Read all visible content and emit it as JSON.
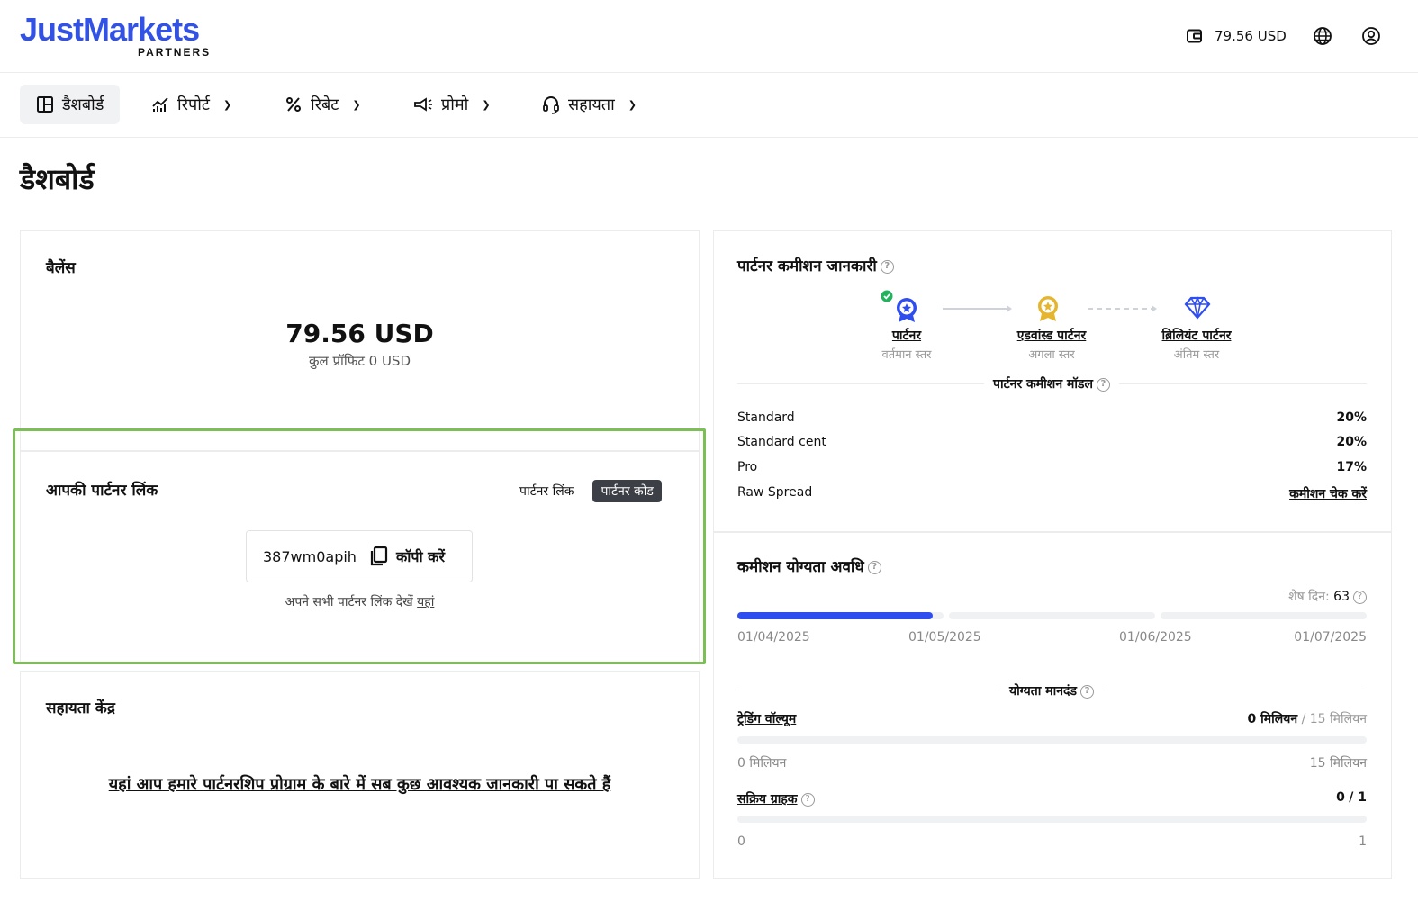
{
  "brand": {
    "name": "JustMarkets",
    "sub": "PARTNERS",
    "color": "#3252e6"
  },
  "header": {
    "balance": "79.56 USD",
    "icons": [
      "wallet-icon",
      "globe-icon",
      "account-icon"
    ]
  },
  "nav": {
    "items": [
      {
        "label": "डैशबोर्ड",
        "icon": "dashboard-icon",
        "active": true
      },
      {
        "label": "रिपोर्ट",
        "icon": "chart-icon",
        "has_dropdown": true
      },
      {
        "label": "रिबेट",
        "icon": "percent-icon",
        "has_dropdown": true
      },
      {
        "label": "प्रोमो",
        "icon": "megaphone-icon",
        "has_dropdown": true
      },
      {
        "label": "सहायता",
        "icon": "headset-icon",
        "has_dropdown": true
      }
    ]
  },
  "page": {
    "title": "डैशबोर्ड"
  },
  "balance_card": {
    "title": "बैलेंस",
    "amount": "79.56 USD",
    "profit": "कुल प्रॉफिट 0 USD"
  },
  "partner_link_card": {
    "title": "आपकी पार्टनर लिंक",
    "toggle": {
      "link_label": "पार्टनर लिंक",
      "code_label": "पार्टनर कोड",
      "selected": "code"
    },
    "code": "387wm0apih",
    "copy_label": "कॉपी करें",
    "see_all_prefix": "अपने सभी पार्टनर लिंक देखें",
    "see_all_link": "यहां"
  },
  "help_card": {
    "title": "सहायता केंद्र",
    "link": "यहां आप हमारे पार्टनरशिप प्रोग्राम के बारे में सब कुछ आवश्यक जानकारी पा सकते हैं"
  },
  "commission_card": {
    "title": "पार्टनर कमीशन जानकारी",
    "levels": [
      {
        "name": "पार्टनर",
        "sub": "वर्तमान स्तर",
        "icon": "partner-badge-icon",
        "color": "#2f4ef0",
        "done": true
      },
      {
        "name": "एडवांस्ड पार्टनर",
        "sub": "अगला स्तर",
        "icon": "advanced-badge-icon",
        "color": "#e6b52e"
      },
      {
        "name": "ब्रिलियंट पार्टनर",
        "sub": "अंतिम स्तर",
        "icon": "diamond-icon",
        "color": "#2f4ef0"
      }
    ],
    "model_title": "पार्टनर कमीशन मॉडल",
    "rates": [
      {
        "account": "Standard",
        "value": "20%"
      },
      {
        "account": "Standard cent",
        "value": "20%"
      },
      {
        "account": "Pro",
        "value": "17%"
      },
      {
        "account": "Raw Spread",
        "value": "कमीशन चेक करें"
      }
    ]
  },
  "eligibility_card": {
    "title": "कमीशन योग्यता अवधि",
    "remaining_label": "शेष दिन:",
    "remaining_days": "63",
    "progress_fraction": 0.31,
    "dates": [
      "01/04/2025",
      "01/05/2025",
      "01/06/2025",
      "01/07/2025"
    ],
    "criteria_title": "योग्यता मानदंड",
    "volume": {
      "label": "ट्रेडिंग वॉल्यूम",
      "current": "0 मिलियन",
      "target": "/ 15 मिलियन",
      "min": "0 मिलियन",
      "max": "15 मिलियन",
      "progress": 0
    },
    "clients": {
      "label": "सक्रिय ग्राहक",
      "current": "0",
      "target": "/ 1",
      "min": "0",
      "max": "1",
      "progress": 0
    }
  }
}
